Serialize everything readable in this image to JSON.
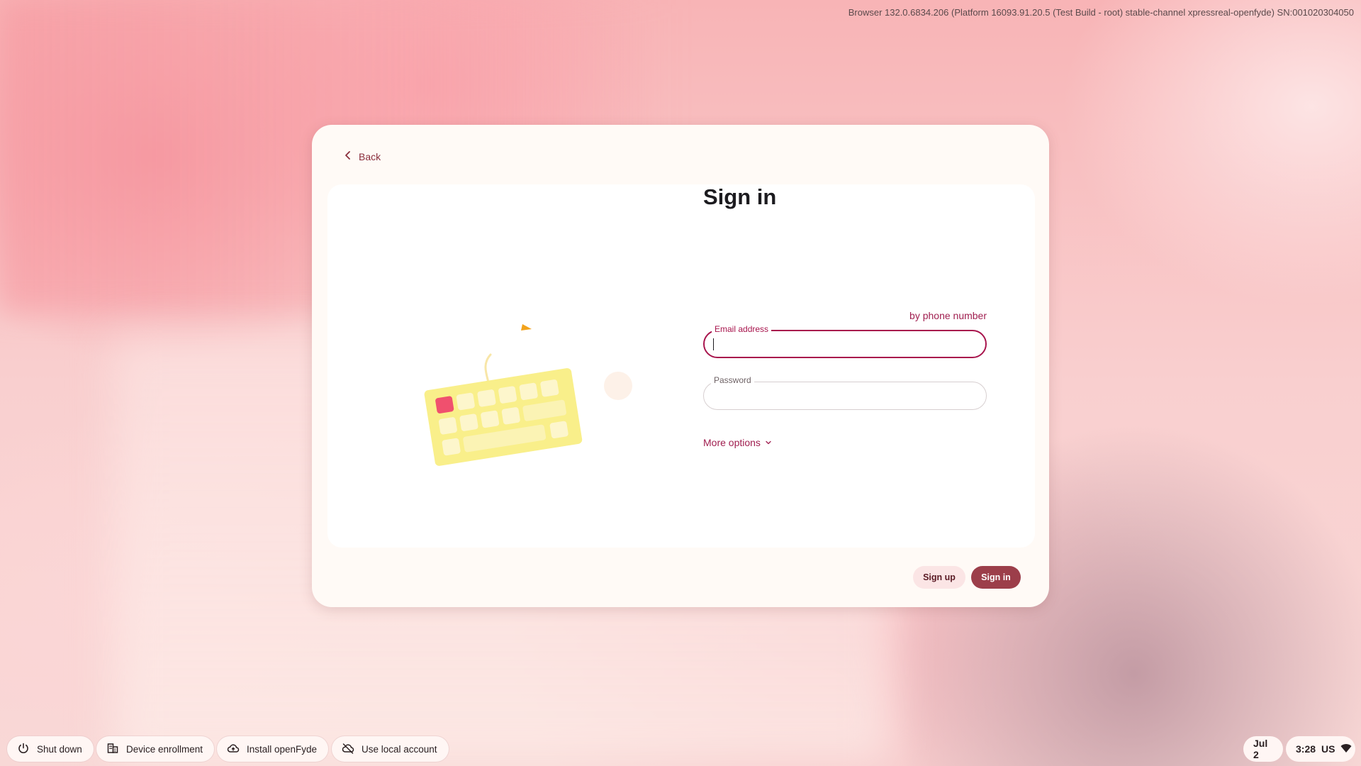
{
  "build_info": "Browser 132.0.6834.206 (Platform 16093.91.20.5 (Test Build - root) stable-channel xpressreal-openfyde) SN:001020304050",
  "dialog": {
    "back_label": "Back",
    "title": "Sign in",
    "phone_link": "by phone number",
    "email_label": "Email address",
    "email_value": "",
    "password_label": "Password",
    "password_value": "",
    "more_options_label": "More options",
    "signup_label": "Sign up",
    "signin_label": "Sign in"
  },
  "shelf": {
    "shutdown_label": "Shut down",
    "enrollment_label": "Device enrollment",
    "install_label": "Install openFyde",
    "local_account_label": "Use local account",
    "date": "Jul 2",
    "time": "3:28",
    "locale": "US"
  },
  "colors": {
    "accent": "#a8154d",
    "primary_button": "#9c3e4a",
    "link": "#a01e4f"
  }
}
